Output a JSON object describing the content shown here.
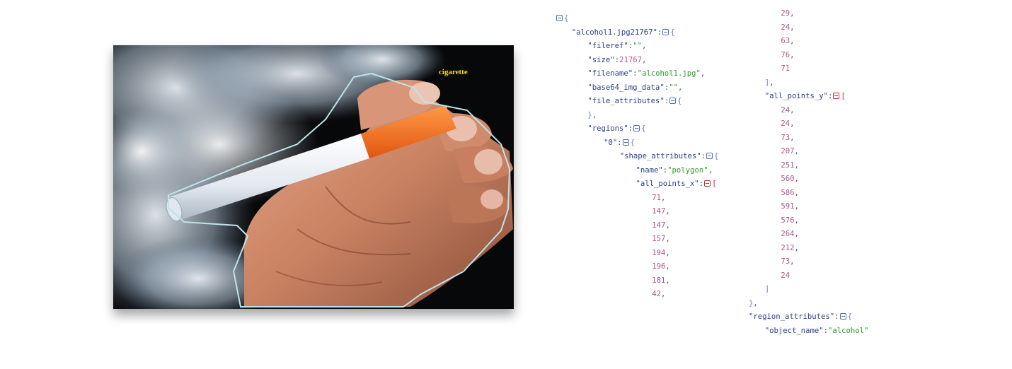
{
  "image": {
    "alt": "hand holding an electronic cigarette in smoke",
    "annotation_label": "cigarette"
  },
  "json_view": {
    "left": [
      {
        "indent": 0,
        "parts": [
          {
            "t": "toggle"
          },
          {
            "t": "brace",
            "v": "{"
          }
        ]
      },
      {
        "indent": 1,
        "parts": [
          {
            "t": "key",
            "v": "\"alcohol1.jpg21767\""
          },
          {
            "t": "punct",
            "v": ":"
          },
          {
            "t": "toggle"
          },
          {
            "t": "brace",
            "v": "{"
          }
        ]
      },
      {
        "indent": 2,
        "parts": [
          {
            "t": "key",
            "v": "\"fileref\""
          },
          {
            "t": "punct",
            "v": ":"
          },
          {
            "t": "str",
            "v": "\"\""
          },
          {
            "t": "punct",
            "v": ","
          }
        ]
      },
      {
        "indent": 2,
        "parts": [
          {
            "t": "key",
            "v": "\"size\""
          },
          {
            "t": "punct",
            "v": ":"
          },
          {
            "t": "num",
            "v": "21767"
          },
          {
            "t": "punct",
            "v": ","
          }
        ]
      },
      {
        "indent": 2,
        "parts": [
          {
            "t": "key",
            "v": "\"filename\""
          },
          {
            "t": "punct",
            "v": ":"
          },
          {
            "t": "str",
            "v": "\"alcohol1.jpg\""
          },
          {
            "t": "punct",
            "v": ","
          }
        ]
      },
      {
        "indent": 2,
        "parts": [
          {
            "t": "key",
            "v": "\"base64_img_data\""
          },
          {
            "t": "punct",
            "v": ":"
          },
          {
            "t": "str",
            "v": "\"\""
          },
          {
            "t": "punct",
            "v": ","
          }
        ]
      },
      {
        "indent": 2,
        "parts": [
          {
            "t": "key",
            "v": "\"file_attributes\""
          },
          {
            "t": "punct",
            "v": ":"
          },
          {
            "t": "toggle"
          },
          {
            "t": "brace",
            "v": "{"
          }
        ]
      },
      {
        "indent": 2,
        "parts": [
          {
            "t": "brace",
            "v": "}"
          },
          {
            "t": "punct",
            "v": ","
          }
        ]
      },
      {
        "indent": 2,
        "parts": [
          {
            "t": "key",
            "v": "\"regions\""
          },
          {
            "t": "punct",
            "v": ":"
          },
          {
            "t": "toggle"
          },
          {
            "t": "brace",
            "v": "{"
          }
        ]
      },
      {
        "indent": 3,
        "parts": [
          {
            "t": "key",
            "v": "\"0\""
          },
          {
            "t": "punct",
            "v": ":"
          },
          {
            "t": "toggle"
          },
          {
            "t": "brace",
            "v": "{"
          }
        ]
      },
      {
        "indent": 4,
        "parts": [
          {
            "t": "key",
            "v": "\"shape_attributes\""
          },
          {
            "t": "punct",
            "v": ":"
          },
          {
            "t": "toggle"
          },
          {
            "t": "brace",
            "v": "{"
          }
        ]
      },
      {
        "indent": 5,
        "parts": [
          {
            "t": "key",
            "v": "\"name\""
          },
          {
            "t": "punct",
            "v": ":"
          },
          {
            "t": "str",
            "v": "\"polygon\""
          },
          {
            "t": "punct",
            "v": ","
          }
        ]
      },
      {
        "indent": 5,
        "parts": [
          {
            "t": "key",
            "v": "\"all_points_x\""
          },
          {
            "t": "punct",
            "v": ":"
          },
          {
            "t": "toggle-red"
          },
          {
            "t": "brace-red",
            "v": "["
          }
        ]
      },
      {
        "indent": 6,
        "parts": [
          {
            "t": "num",
            "v": "71"
          },
          {
            "t": "punct",
            "v": ","
          }
        ]
      },
      {
        "indent": 6,
        "parts": [
          {
            "t": "num",
            "v": "147"
          },
          {
            "t": "punct",
            "v": ","
          }
        ]
      },
      {
        "indent": 6,
        "parts": [
          {
            "t": "num",
            "v": "147"
          },
          {
            "t": "punct",
            "v": ","
          }
        ]
      },
      {
        "indent": 6,
        "parts": [
          {
            "t": "num",
            "v": "157"
          },
          {
            "t": "punct",
            "v": ","
          }
        ]
      },
      {
        "indent": 6,
        "parts": [
          {
            "t": "num",
            "v": "194"
          },
          {
            "t": "punct",
            "v": ","
          }
        ]
      },
      {
        "indent": 6,
        "parts": [
          {
            "t": "num",
            "v": "196"
          },
          {
            "t": "punct",
            "v": ","
          }
        ]
      },
      {
        "indent": 6,
        "parts": [
          {
            "t": "num",
            "v": "181"
          },
          {
            "t": "punct",
            "v": ","
          }
        ]
      },
      {
        "indent": 6,
        "parts": [
          {
            "t": "num",
            "v": "42"
          },
          {
            "t": "punct",
            "v": ","
          }
        ]
      }
    ],
    "right": [
      {
        "indent": 2,
        "parts": [
          {
            "t": "num",
            "v": "29"
          },
          {
            "t": "punct",
            "v": ","
          }
        ]
      },
      {
        "indent": 2,
        "parts": [
          {
            "t": "num",
            "v": "24"
          },
          {
            "t": "punct",
            "v": ","
          }
        ]
      },
      {
        "indent": 2,
        "parts": [
          {
            "t": "num",
            "v": "63"
          },
          {
            "t": "punct",
            "v": ","
          }
        ]
      },
      {
        "indent": 2,
        "parts": [
          {
            "t": "num",
            "v": "76"
          },
          {
            "t": "punct",
            "v": ","
          }
        ]
      },
      {
        "indent": 2,
        "parts": [
          {
            "t": "num",
            "v": "71"
          }
        ]
      },
      {
        "indent": 1,
        "parts": [
          {
            "t": "brace",
            "v": "]"
          },
          {
            "t": "punct",
            "v": ","
          }
        ]
      },
      {
        "indent": 1,
        "parts": [
          {
            "t": "key",
            "v": "\"all_points_y\""
          },
          {
            "t": "punct",
            "v": ":"
          },
          {
            "t": "toggle-red"
          },
          {
            "t": "brace-red",
            "v": "["
          }
        ]
      },
      {
        "indent": 2,
        "parts": [
          {
            "t": "num",
            "v": "24"
          },
          {
            "t": "punct",
            "v": ","
          }
        ]
      },
      {
        "indent": 2,
        "parts": [
          {
            "t": "num",
            "v": "24"
          },
          {
            "t": "punct",
            "v": ","
          }
        ]
      },
      {
        "indent": 2,
        "parts": [
          {
            "t": "num",
            "v": "73"
          },
          {
            "t": "punct",
            "v": ","
          }
        ]
      },
      {
        "indent": 2,
        "parts": [
          {
            "t": "num",
            "v": "207"
          },
          {
            "t": "punct",
            "v": ","
          }
        ]
      },
      {
        "indent": 2,
        "parts": [
          {
            "t": "num",
            "v": "251"
          },
          {
            "t": "punct",
            "v": ","
          }
        ]
      },
      {
        "indent": 2,
        "parts": [
          {
            "t": "num",
            "v": "560"
          },
          {
            "t": "punct",
            "v": ","
          }
        ]
      },
      {
        "indent": 2,
        "parts": [
          {
            "t": "num",
            "v": "586"
          },
          {
            "t": "punct",
            "v": ","
          }
        ]
      },
      {
        "indent": 2,
        "parts": [
          {
            "t": "num",
            "v": "591"
          },
          {
            "t": "punct",
            "v": ","
          }
        ]
      },
      {
        "indent": 2,
        "parts": [
          {
            "t": "num",
            "v": "576"
          },
          {
            "t": "punct",
            "v": ","
          }
        ]
      },
      {
        "indent": 2,
        "parts": [
          {
            "t": "num",
            "v": "264"
          },
          {
            "t": "punct",
            "v": ","
          }
        ]
      },
      {
        "indent": 2,
        "parts": [
          {
            "t": "num",
            "v": "212"
          },
          {
            "t": "punct",
            "v": ","
          }
        ]
      },
      {
        "indent": 2,
        "parts": [
          {
            "t": "num",
            "v": "73"
          },
          {
            "t": "punct",
            "v": ","
          }
        ]
      },
      {
        "indent": 2,
        "parts": [
          {
            "t": "num",
            "v": "24"
          }
        ]
      },
      {
        "indent": 1,
        "parts": [
          {
            "t": "brace",
            "v": "]"
          }
        ]
      },
      {
        "indent": 0,
        "parts": [
          {
            "t": "brace",
            "v": "}"
          },
          {
            "t": "punct",
            "v": ","
          }
        ]
      },
      {
        "indent": 0,
        "parts": [
          {
            "t": "key",
            "v": "\"region_attributes\""
          },
          {
            "t": "punct",
            "v": ":"
          },
          {
            "t": "toggle"
          },
          {
            "t": "brace",
            "v": "{"
          }
        ]
      },
      {
        "indent": 1,
        "parts": [
          {
            "t": "key",
            "v": "\"object_name\""
          },
          {
            "t": "punct",
            "v": ":"
          },
          {
            "t": "str",
            "v": "\"alcohol\""
          }
        ]
      }
    ]
  },
  "colors": {
    "key": "#2b3f8a",
    "string": "#2c9b2c",
    "number": "#b0558a",
    "toggle": "#4a6fb3",
    "toggle_array": "#b8312f",
    "annotation_outline": "#bfe3ea",
    "annotation_label": "#f2e000"
  }
}
